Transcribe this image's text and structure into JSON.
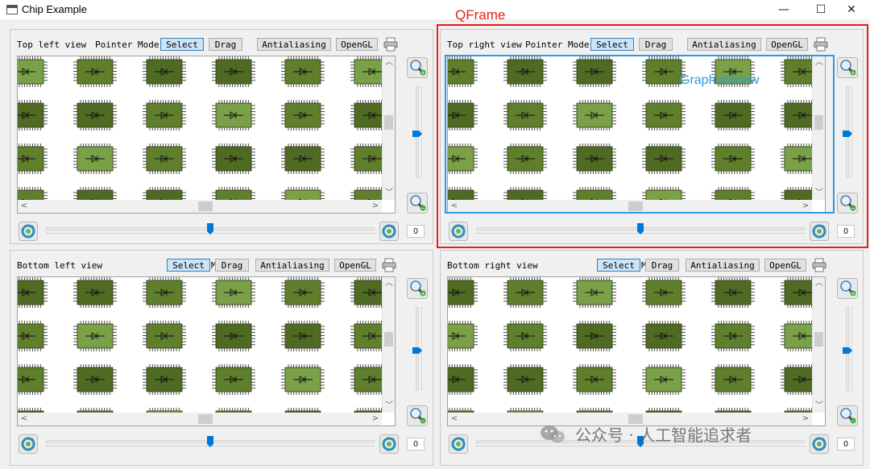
{
  "window": {
    "title": "Chip Example",
    "minimize_glyph": "—",
    "maximize_glyph": "☐",
    "close_glyph": "✕"
  },
  "toolbar_labels": {
    "pointer_mode": "Pointer Mode",
    "select": "Select",
    "drag": "Drag",
    "antialiasing": "Antialiasing",
    "opengl": "OpenGL"
  },
  "views": [
    {
      "id": "top-left",
      "title": "Top left view",
      "rotation_value": "0"
    },
    {
      "id": "top-right",
      "title": "Top right view",
      "rotation_value": "0"
    },
    {
      "id": "bottom-left",
      "title": "Bottom left view",
      "rotation_value": "0"
    },
    {
      "id": "bottom-right",
      "title": "Bottom right view",
      "rotation_value": "0"
    }
  ],
  "annotations": {
    "frame_label": "QFrame",
    "graphicsview_label": "GraphicsView",
    "frame_color": "#e3201b",
    "graphicsview_color": "#2a9be0"
  },
  "watermark": "公众号 · 人工智能追求者",
  "colors": {
    "chip_dark": "#4f6b23",
    "chip_mid": "#5f7f2c",
    "chip_light": "#7aa048",
    "select_checked": "#cce4f7",
    "slider_handle": "#0078d7"
  }
}
